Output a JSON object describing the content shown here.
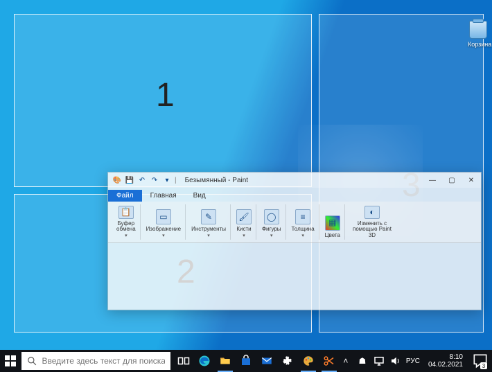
{
  "desktop": {
    "recycle_bin_label": "Корзина"
  },
  "snap": {
    "zone1_label": "1",
    "zone2_label": "2",
    "zone3_label": "3"
  },
  "paint": {
    "title": "Безымянный - Paint",
    "tabs": {
      "file": "Файл",
      "home": "Главная",
      "view": "Вид"
    },
    "ribbon": {
      "clipboard": "Буфер\nобмена",
      "image": "Изображение",
      "tools": "Инструменты",
      "brushes": "Кисти",
      "shapes": "Фигуры",
      "size": "Толщина",
      "colors": "Цвета",
      "paint3d": "Изменить с\nпомощью Paint 3D"
    }
  },
  "taskbar": {
    "search_placeholder": "Введите здесь текст для поиска",
    "lang": "РУС",
    "time": "8:10",
    "date": "04.02.2021",
    "notification_count": "3"
  }
}
